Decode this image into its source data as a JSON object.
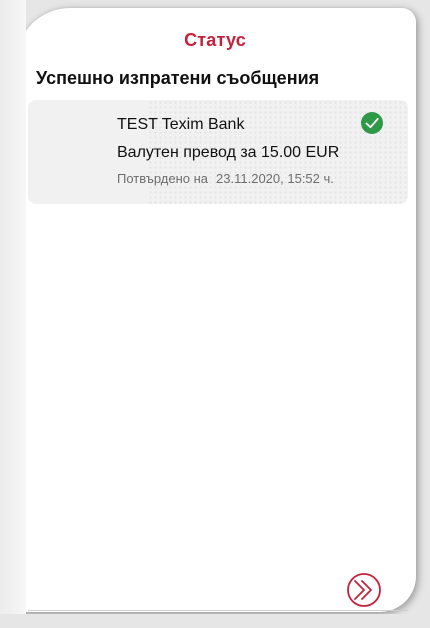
{
  "header": {
    "title": "Статус"
  },
  "section": {
    "title": "Успешно изпратени съобщения"
  },
  "messages": [
    {
      "sender": "TEST Texim Bank",
      "subject": "Валутен превод за 15.00 EUR",
      "confirmed_label": "Потвърдено на",
      "confirmed_datetime": "23.11.2020, 15:52 ч.",
      "status_icon": "check-circle-icon"
    }
  ],
  "footer": {
    "next_icon": "double-chevron-right-icon"
  },
  "colors": {
    "accent": "#c4223b",
    "success": "#2e9a48",
    "item_background": "#f1f1f1",
    "muted_text": "#6e6e6e"
  }
}
